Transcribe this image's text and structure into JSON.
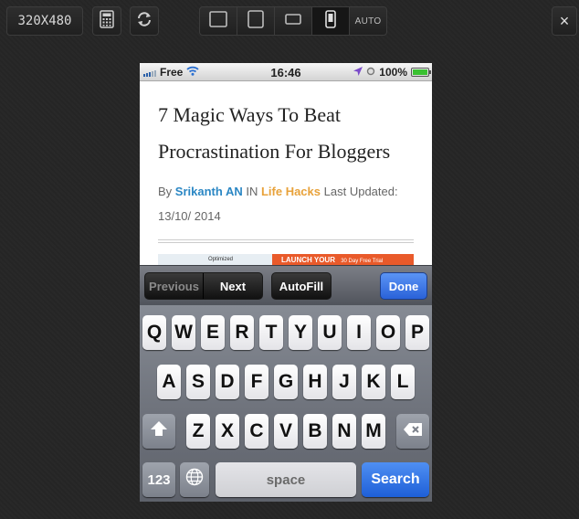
{
  "toolbar": {
    "resolution": "320X480",
    "calculator_icon": "calculator-icon",
    "rotate_icon": "rotate-icon",
    "devices": [
      {
        "name": "desktop-icon",
        "label": ""
      },
      {
        "name": "tablet-icon",
        "label": ""
      },
      {
        "name": "tablet-landscape-icon",
        "label": ""
      },
      {
        "name": "phone-icon",
        "label": ""
      },
      {
        "name": "auto",
        "label": "AUTO"
      }
    ],
    "active_device": "phone",
    "close_label": "×"
  },
  "statusbar": {
    "carrier": "Free",
    "time": "16:46",
    "battery": "100%",
    "battery_level": 1.0
  },
  "article": {
    "title": "7 Magic Ways To Beat Procrastination For Bloggers",
    "by": "By",
    "author": "Srikanth AN",
    "in": "IN",
    "category": "Life Hacks",
    "updated_label": "Last Updated:",
    "date": "13/10/ 2014"
  },
  "ad": {
    "left_text": "Optimized",
    "right_text": "LAUNCH YOUR",
    "right_sub": "30 Day Free Trial"
  },
  "accessory": {
    "previous": "Previous",
    "next": "Next",
    "autofill": "AutoFill",
    "done": "Done"
  },
  "keyboard": {
    "row1": [
      "Q",
      "W",
      "E",
      "R",
      "T",
      "Y",
      "U",
      "I",
      "O",
      "P"
    ],
    "row2": [
      "A",
      "S",
      "D",
      "F",
      "G",
      "H",
      "J",
      "K",
      "L"
    ],
    "row3": [
      "Z",
      "X",
      "C",
      "V",
      "B",
      "N",
      "M"
    ],
    "numbers": "123",
    "space": "space",
    "search": "Search"
  },
  "colors": {
    "background": "#262626",
    "author": "#2b87c4",
    "category": "#e8a23a",
    "done_button": "#2a62d9",
    "search_key": "#1e5fd8"
  }
}
